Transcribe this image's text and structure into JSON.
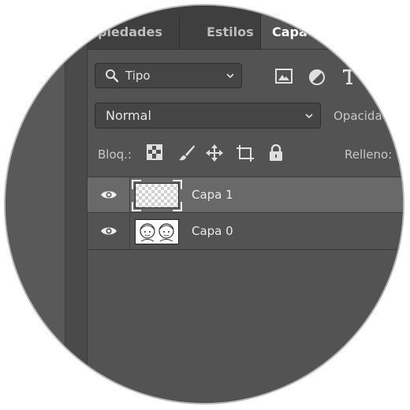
{
  "tabs": [
    {
      "label": "opiedades",
      "active": false
    },
    {
      "label": "Estilos",
      "active": false
    },
    {
      "label": "Capa",
      "active": true
    }
  ],
  "filter": {
    "label": "Tipo",
    "icon": "search-icon"
  },
  "filter_tools": [
    "image-filter-icon",
    "adjustment-filter-icon",
    "type-filter-icon"
  ],
  "blend": {
    "mode": "Normal",
    "opacity_label": "Opacidad"
  },
  "lock": {
    "label": "Bloq.:",
    "fill_label": "Relleno:",
    "icons": [
      "lock-transparent-pixels-icon",
      "lock-image-pixels-icon",
      "lock-position-icon",
      "lock-artboard-icon",
      "lock-all-icon"
    ]
  },
  "layers": [
    {
      "name": "Capa 1",
      "selected": true,
      "visible": true,
      "thumbnail": "transparent"
    },
    {
      "name": "Capa 0",
      "selected": false,
      "visible": true,
      "thumbnail": "drawing"
    }
  ],
  "colors": {
    "panel": "#535353",
    "tabbar": "#3f3f3f",
    "selected_row": "#696969",
    "text": "#eaeaea"
  }
}
